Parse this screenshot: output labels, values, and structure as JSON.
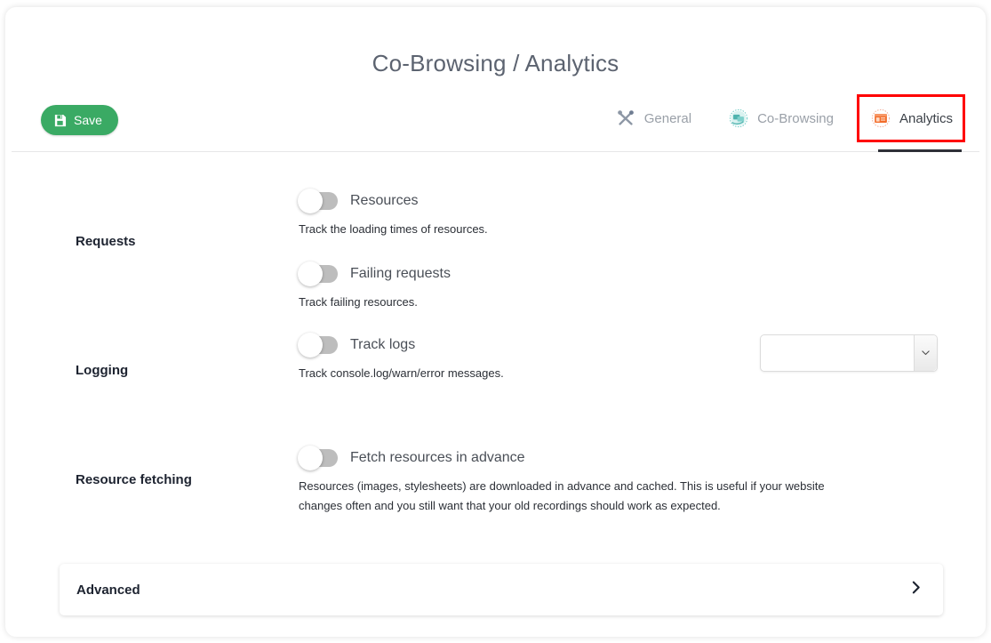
{
  "header": {
    "title": "Co-Browsing / Analytics",
    "save_label": "Save",
    "save_icon": "save-icon",
    "save_color": "#3aaa64"
  },
  "tabs": [
    {
      "label": "General",
      "icon": "tools-icon",
      "active": false
    },
    {
      "label": "Co-Browsing",
      "icon": "cobrowsing-icon",
      "active": false
    },
    {
      "label": "Analytics",
      "icon": "analytics-icon",
      "active": true
    }
  ],
  "annotation": {
    "target": "Analytics",
    "color": "#ff0000"
  },
  "sections": [
    {
      "label": "Requests",
      "rows": [
        {
          "label": "Resources",
          "description": "Track the loading times of resources.",
          "toggle_state": "off"
        },
        {
          "label": "Failing requests",
          "description": "Track failing resources.",
          "toggle_state": "off"
        }
      ]
    },
    {
      "label": "Logging",
      "rows": [
        {
          "label": "Track logs",
          "description": "Track console.log/warn/error messages.",
          "toggle_state": "off"
        }
      ],
      "select": {
        "value": "",
        "placeholder": "",
        "icon": "chevron-down-icon"
      }
    },
    {
      "label": "Resource fetching",
      "rows": [
        {
          "label": "Fetch resources in advance",
          "description": "Resources (images, stylesheets) are downloaded in advance and cached. This is useful if your website changes often and you still want that your old recordings should work as expected.",
          "toggle_state": "off"
        }
      ]
    }
  ],
  "advanced": {
    "title": "Advanced",
    "icon": "chevron-right-icon"
  }
}
